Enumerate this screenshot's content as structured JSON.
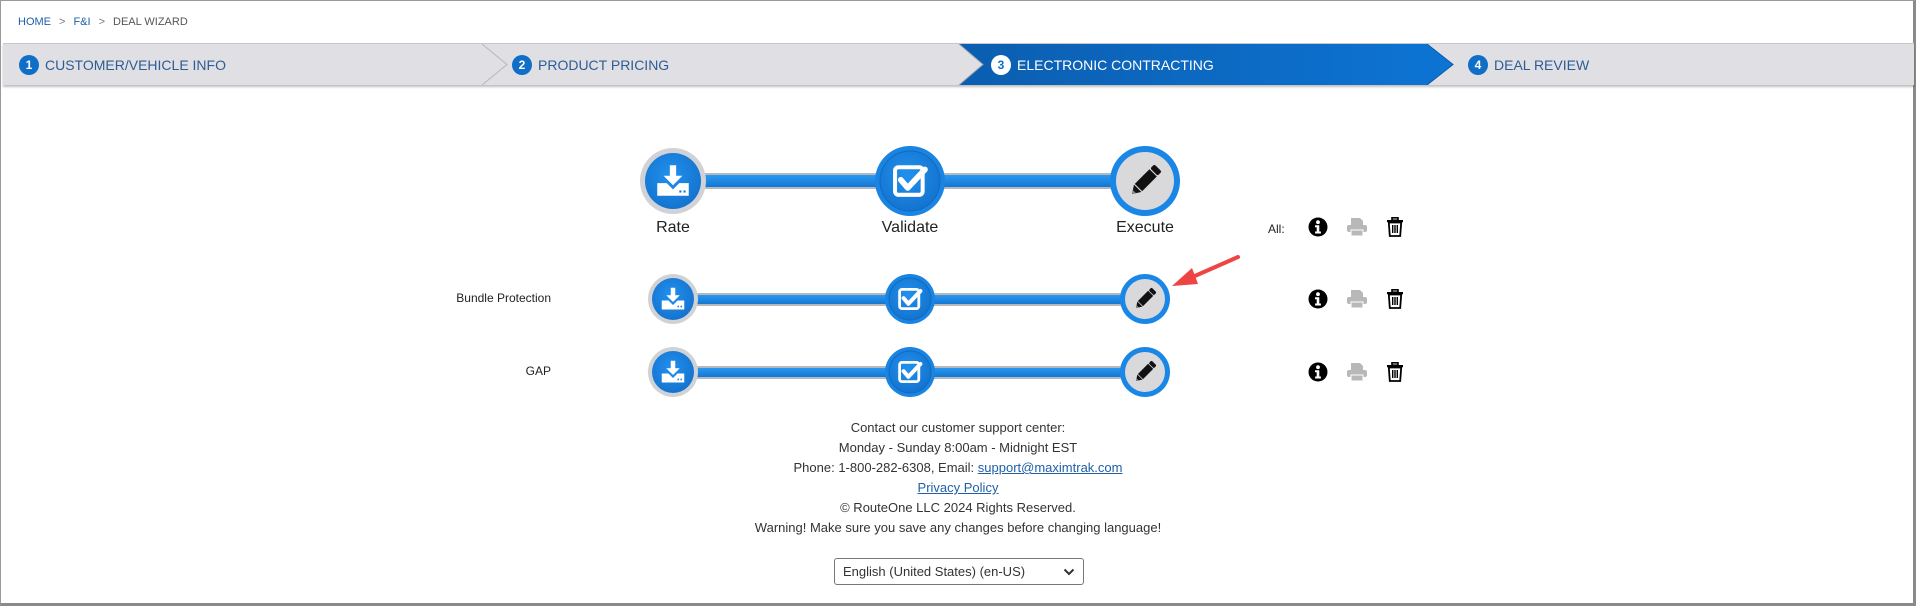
{
  "breadcrumb": {
    "items": [
      {
        "label": "HOME",
        "link": true
      },
      {
        "label": "F&I",
        "link": true
      },
      {
        "label": "DEAL WIZARD",
        "link": false
      }
    ],
    "separator": ">"
  },
  "wizard": {
    "steps": [
      {
        "number": "1",
        "label": "CUSTOMER/VEHICLE INFO",
        "active": false
      },
      {
        "number": "2",
        "label": "PRODUCT PRICING",
        "active": false
      },
      {
        "number": "3",
        "label": "ELECTRONIC CONTRACTING",
        "active": true
      },
      {
        "number": "4",
        "label": "DEAL REVIEW",
        "active": false
      }
    ],
    "colors": {
      "active": "#0a66c2",
      "inactive_bg": "#e0e0e4",
      "text": "#2d5c95"
    }
  },
  "contracting": {
    "stages": [
      {
        "label": "Rate",
        "icon": "download-icon"
      },
      {
        "label": "Validate",
        "icon": "checkbox-icon"
      },
      {
        "label": "Execute",
        "icon": "pencil-icon"
      }
    ],
    "all_label": "All:",
    "actions": [
      {
        "name": "info",
        "icon": "info-icon",
        "enabled": true
      },
      {
        "name": "print",
        "icon": "print-icon",
        "enabled": false
      },
      {
        "name": "delete",
        "icon": "trash-icon",
        "enabled": true
      }
    ],
    "products": [
      {
        "name": "Bundle Protection",
        "highlighted_stage": "Execute"
      },
      {
        "name": "GAP"
      }
    ],
    "colors": {
      "stage_blue": "#1a87e6",
      "execute_bg": "#d9d9dc",
      "annotation_arrow": "#ef4444"
    }
  },
  "footer": {
    "line1": "Contact our customer support center:",
    "line2": "Monday - Sunday 8:00am - Midnight EST",
    "phone_prefix": "Phone: 1-800-282-6308, Email: ",
    "email": "support@maximtrak.com",
    "privacy": "Privacy Policy",
    "copyright": "© RouteOne LLC 2024 Rights Reserved.",
    "warning": "Warning! Make sure you save any changes before changing language!",
    "language_selected": "English (United States) (en-US)"
  }
}
